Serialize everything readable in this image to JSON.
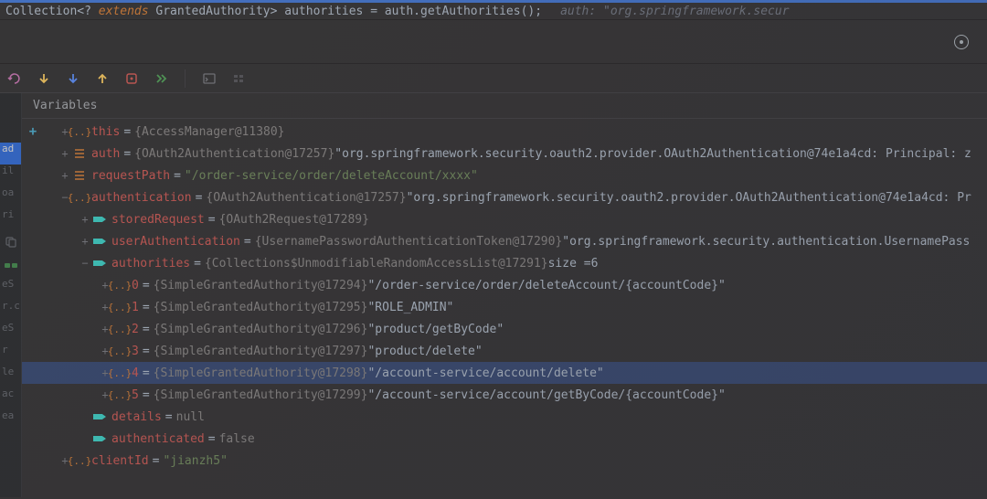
{
  "code_line": {
    "type": "Collection",
    "generic_open": "<?",
    "extends": "extends",
    "generic_class": "GrantedAuthority",
    "generic_close": ">",
    "var_name": "authorities",
    "assign": "=",
    "obj": "auth",
    "dot": ".",
    "method": "getAuthorities",
    "parens": "();",
    "hint": "auth: \"org.springframework.secur"
  },
  "toolbar": {
    "redo": "↷",
    "down1": "↓",
    "down2": "↓",
    "up": "↑",
    "forward": "⏭"
  },
  "gutter": {
    "items": [
      {
        "label": ""
      },
      {
        "label": "ad",
        "active": true
      },
      {
        "label": "il"
      },
      {
        "label": "oa"
      },
      {
        "label": "ri"
      },
      {
        "label": "eS"
      },
      {
        "label": "r.c"
      },
      {
        "label": "eS"
      },
      {
        "label": "r"
      },
      {
        "label": "le"
      },
      {
        "label": "ac"
      },
      {
        "label": "ea"
      },
      {
        "label": ""
      }
    ]
  },
  "panel": {
    "title": "Variables"
  },
  "tree": {
    "nodes": [
      {
        "depth": 0,
        "expander": "+",
        "icon": "braces",
        "name": "this",
        "eq": "=",
        "ref": "{AccessManager@11380}",
        "tail": ""
      },
      {
        "depth": 0,
        "expander": "+",
        "icon": "struct",
        "name": "auth",
        "eq": "=",
        "ref": "{OAuth2Authentication@17257}",
        "str": "\"org.springframework.security.oauth2.provider.OAuth2Authentication@74e1a4cd: Principal: z"
      },
      {
        "depth": 0,
        "expander": "+",
        "icon": "struct",
        "name": "requestPath",
        "eq": "=",
        "str": "\"/order-service/order/deleteAccount/xxxx\""
      },
      {
        "depth": 0,
        "expander": "−",
        "icon": "braces",
        "name": "authentication",
        "eq": "=",
        "ref": "{OAuth2Authentication@17257}",
        "str": "\"org.springframework.security.oauth2.provider.OAuth2Authentication@74e1a4cd: Pr"
      },
      {
        "depth": 1,
        "expander": "+",
        "icon": "tag",
        "name": "storedRequest",
        "eq": "=",
        "ref": "{OAuth2Request@17289}"
      },
      {
        "depth": 1,
        "expander": "+",
        "icon": "tag",
        "name": "userAuthentication",
        "eq": "=",
        "ref": "{UsernamePasswordAuthenticationToken@17290}",
        "str": "\"org.springframework.security.authentication.UsernamePass"
      },
      {
        "depth": 1,
        "expander": "−",
        "icon": "tag",
        "name": "authorities",
        "eq": "=",
        "ref": "{Collections$UnmodifiableRandomAccessList@17291}",
        "size_label": "  size = ",
        "size_val": "6"
      },
      {
        "depth": 2,
        "expander": "+",
        "icon": "braces",
        "idx": "0",
        "eq": "=",
        "ref": "{SimpleGrantedAuthority@17294}",
        "str": "\"/order-service/order/deleteAccount/{accountCode}\""
      },
      {
        "depth": 2,
        "expander": "+",
        "icon": "braces",
        "idx": "1",
        "eq": "=",
        "ref": "{SimpleGrantedAuthority@17295}",
        "str": "\"ROLE_ADMIN\""
      },
      {
        "depth": 2,
        "expander": "+",
        "icon": "braces",
        "idx": "2",
        "eq": "=",
        "ref": "{SimpleGrantedAuthority@17296}",
        "str": "\"product/getByCode\""
      },
      {
        "depth": 2,
        "expander": "+",
        "icon": "braces",
        "idx": "3",
        "eq": "=",
        "ref": "{SimpleGrantedAuthority@17297}",
        "str": "\"product/delete\""
      },
      {
        "depth": 2,
        "expander": "+",
        "icon": "braces",
        "idx": "4",
        "eq": "=",
        "ref": "{SimpleGrantedAuthority@17298}",
        "str": "\"/account-service/account/delete\"",
        "selected": true
      },
      {
        "depth": 2,
        "expander": "+",
        "icon": "braces",
        "idx": "5",
        "eq": "=",
        "ref": "{SimpleGrantedAuthority@17299}",
        "str": "\"/account-service/account/getByCode/{accountCode}\""
      },
      {
        "depth": 1,
        "expander": "",
        "icon": "tag",
        "name": "details",
        "eq": "=",
        "null_val": "null"
      },
      {
        "depth": 1,
        "expander": "",
        "icon": "tag",
        "name": "authenticated",
        "eq": "=",
        "bool_val": "false"
      },
      {
        "depth": 0,
        "expander": "+",
        "icon": "braces",
        "name": "clientId",
        "eq": "=",
        "str": "\"jianzh5\""
      }
    ]
  }
}
